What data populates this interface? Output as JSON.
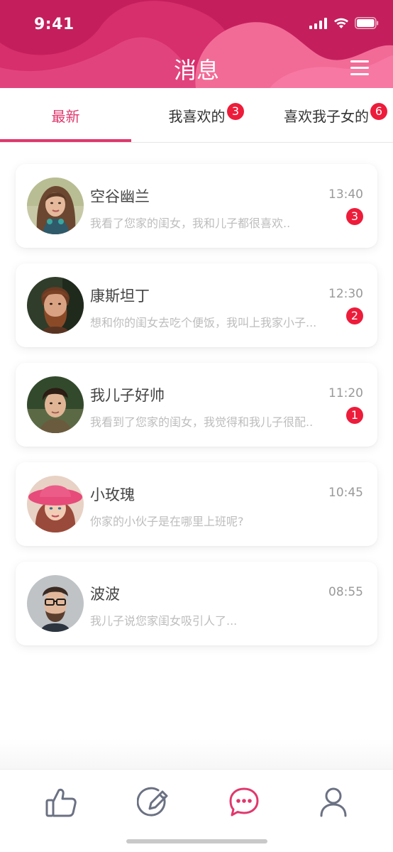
{
  "status_bar": {
    "time": "9:41"
  },
  "header": {
    "title": "消息"
  },
  "tabs": [
    {
      "label": "最新",
      "badge": null,
      "active": true
    },
    {
      "label": "我喜欢的",
      "badge": "3",
      "active": false
    },
    {
      "label": "喜欢我子女的",
      "badge": "6",
      "active": false
    }
  ],
  "messages": [
    {
      "name": "空谷幽兰",
      "time": "13:40",
      "preview": "我看了您家的闺女，我和儿子都很喜欢..",
      "unread": "3",
      "avatar_icon": "woman-portrait-avatar"
    },
    {
      "name": "康斯坦丁",
      "time": "12:30",
      "preview": "想和你的闺女去吃个便饭，我叫上我家小子...",
      "unread": "2",
      "avatar_icon": "bearded-man-avatar"
    },
    {
      "name": "我儿子好帅",
      "time": "11:20",
      "preview": "我看到了您家的闺女，我觉得和我儿子很配..",
      "unread": "1",
      "avatar_icon": "young-man-avatar"
    },
    {
      "name": "小玫瑰",
      "time": "10:45",
      "preview": "你家的小伙子是在哪里上班呢?",
      "unread": null,
      "avatar_icon": "woman-pink-hat-avatar"
    },
    {
      "name": "波波",
      "time": "08:55",
      "preview": "我儿子说您家闺女吸引人了...",
      "unread": null,
      "avatar_icon": "man-glasses-avatar"
    }
  ],
  "bottom_nav": [
    {
      "icon": "thumbs-up-icon",
      "active": false
    },
    {
      "icon": "edit-icon",
      "active": false
    },
    {
      "icon": "chat-bubble-icon",
      "active": true
    },
    {
      "icon": "profile-icon",
      "active": false
    }
  ],
  "colors": {
    "brand": "#c41f5c",
    "accent": "#e0386d",
    "badge": "#ed1c3a",
    "inactive_icon": "#6b7183"
  }
}
